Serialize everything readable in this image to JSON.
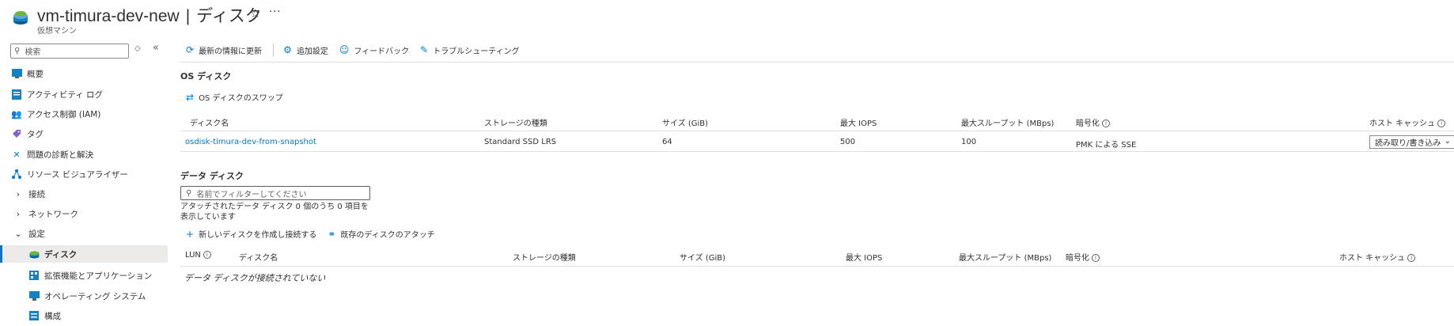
{
  "header": {
    "vm_name": "vm-timura-dev-new",
    "separator": "|",
    "page": "ディスク",
    "subtitle": "仮想マシン"
  },
  "sidebar": {
    "search_placeholder": "検索",
    "items": [
      {
        "label": "概要",
        "icon": "overview-icon"
      },
      {
        "label": "アクティビティ ログ",
        "icon": "activity-log-icon"
      },
      {
        "label": "アクセス制御 (IAM)",
        "icon": "iam-icon"
      },
      {
        "label": "タグ",
        "icon": "tag-icon"
      },
      {
        "label": "問題の診断と解決",
        "icon": "wrench-icon"
      },
      {
        "label": "リソース ビジュアライザー",
        "icon": "visualizer-icon"
      },
      {
        "label": "接続",
        "icon": "chevron-right-icon"
      },
      {
        "label": "ネットワーク",
        "icon": "chevron-right-icon"
      },
      {
        "label": "設定",
        "icon": "chevron-down-icon"
      },
      {
        "label": "ディスク",
        "icon": "disk-icon",
        "active": true
      },
      {
        "label": "拡張機能とアプリケーション",
        "icon": "extensions-icon"
      },
      {
        "label": "オペレーティング システム",
        "icon": "os-icon"
      },
      {
        "label": "構成",
        "icon": "configuration-icon"
      }
    ]
  },
  "toolbar": {
    "refresh": "最新の情報に更新",
    "settings": "追加設定",
    "feedback": "フィードバック",
    "troubleshoot": "トラブルシューティング"
  },
  "os_disk": {
    "title": "OS ディスク",
    "swap": "OS ディスクのスワップ",
    "headers": {
      "name": "ディスク名",
      "storage": "ストレージの種類",
      "size": "サイズ (GiB)",
      "iops": "最大 IOPS",
      "throughput": "最大スループット (MBps)",
      "encryption": "暗号化",
      "cache": "ホスト キャッシュ"
    },
    "row": {
      "name": "osdisk-timura-dev-from-snapshot",
      "storage": "Standard SSD LRS",
      "size": "64",
      "iops": "500",
      "throughput": "100",
      "encryption": "PMK による SSE",
      "cache": "読み取り/書き込み"
    }
  },
  "data_disk": {
    "title": "データ ディスク",
    "filter_placeholder": "名前でフィルターしてください",
    "count_text": "アタッチされたデータ ディスク 0 個のうち 0 項目を表示しています",
    "create_attach": "新しいディスクを作成し接続する",
    "attach_existing": "既存のディスクのアタッチ",
    "headers": {
      "lun": "LUN",
      "name": "ディスク名",
      "storage": "ストレージの種類",
      "size": "サイズ (GiB)",
      "iops": "最大 IOPS",
      "throughput": "最大スループット (MBps)",
      "encryption": "暗号化",
      "cache": "ホスト キャッシュ"
    },
    "empty": "データ ディスクが接続されていない"
  }
}
